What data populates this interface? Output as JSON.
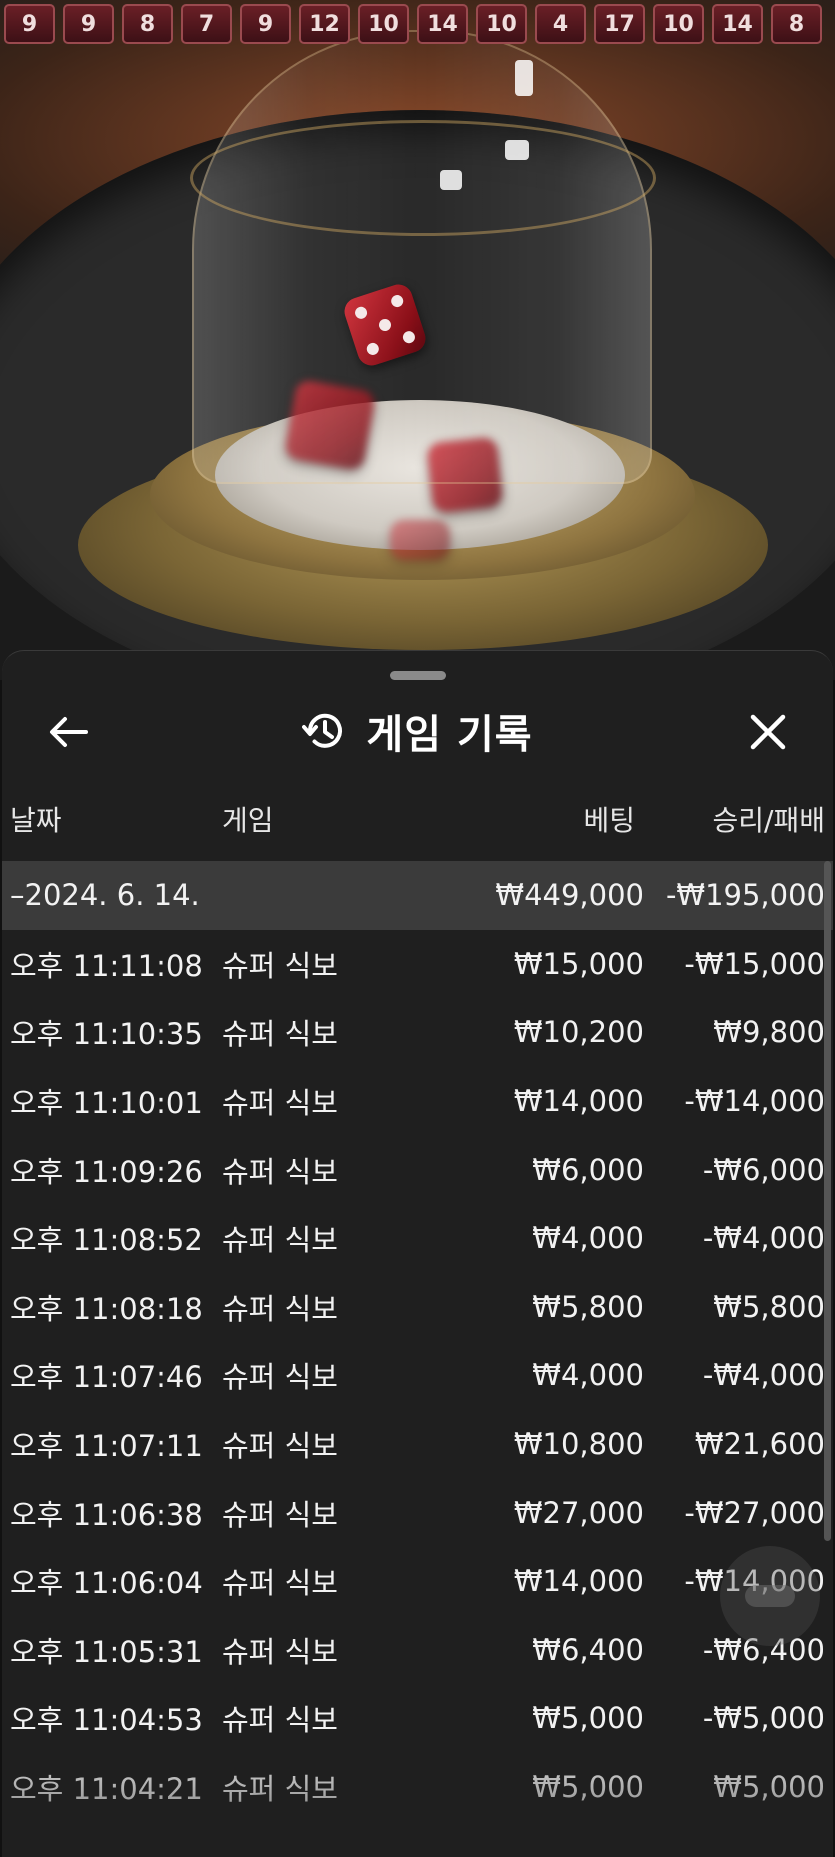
{
  "results_strip": [
    "9",
    "9",
    "8",
    "7",
    "9",
    "12",
    "10",
    "14",
    "10",
    "4",
    "17",
    "10",
    "14",
    "8"
  ],
  "history": {
    "title": "게임 기록",
    "icons": {
      "back": "arrow-left-icon",
      "history": "history-clock-icon",
      "close": "close-icon"
    },
    "columns": {
      "date": "날짜",
      "game": "게임",
      "bet": "베팅",
      "result": "승리/패배"
    },
    "summary": {
      "date": "–2024. 6. 14.",
      "bet": "₩449,000",
      "result": "-₩195,000"
    },
    "rows": [
      {
        "time": "오후 11:11:08",
        "game": "슈퍼 식보",
        "bet": "₩15,000",
        "result": "-₩15,000"
      },
      {
        "time": "오후 11:10:35",
        "game": "슈퍼 식보",
        "bet": "₩10,200",
        "result": "₩9,800"
      },
      {
        "time": "오후 11:10:01",
        "game": "슈퍼 식보",
        "bet": "₩14,000",
        "result": "-₩14,000"
      },
      {
        "time": "오후 11:09:26",
        "game": "슈퍼 식보",
        "bet": "₩6,000",
        "result": "-₩6,000"
      },
      {
        "time": "오후 11:08:52",
        "game": "슈퍼 식보",
        "bet": "₩4,000",
        "result": "-₩4,000"
      },
      {
        "time": "오후 11:08:18",
        "game": "슈퍼 식보",
        "bet": "₩5,800",
        "result": "₩5,800"
      },
      {
        "time": "오후 11:07:46",
        "game": "슈퍼 식보",
        "bet": "₩4,000",
        "result": "-₩4,000"
      },
      {
        "time": "오후 11:07:11",
        "game": "슈퍼 식보",
        "bet": "₩10,800",
        "result": "₩21,600"
      },
      {
        "time": "오후 11:06:38",
        "game": "슈퍼 식보",
        "bet": "₩27,000",
        "result": "-₩27,000"
      },
      {
        "time": "오후 11:06:04",
        "game": "슈퍼 식보",
        "bet": "₩14,000",
        "result": "-₩14,000"
      },
      {
        "time": "오후 11:05:31",
        "game": "슈퍼 식보",
        "bet": "₩6,400",
        "result": "-₩6,400"
      },
      {
        "time": "오후 11:04:53",
        "game": "슈퍼 식보",
        "bet": "₩5,000",
        "result": "-₩5,000"
      },
      {
        "time": "오후 11:04:21",
        "game": "슈퍼 식보",
        "bet": "₩5,000",
        "result": "₩5,000"
      }
    ]
  }
}
